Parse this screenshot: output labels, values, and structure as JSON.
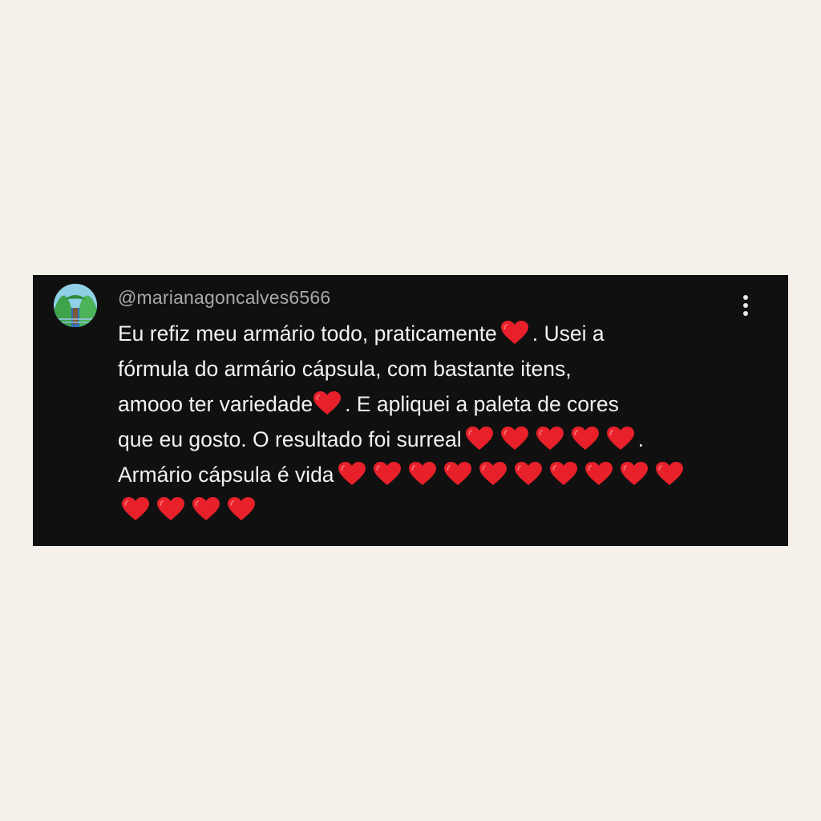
{
  "comment": {
    "username": "@marianagoncalves6566",
    "lines": [
      {
        "before": "Eu refiz meu armário todo, praticamente",
        "hearts": 1,
        "after": ". Usei a"
      },
      {
        "before": "fórmula do armário cápsula, com bastante itens,",
        "hearts": 0,
        "after": ""
      },
      {
        "before": "amooo ter variedade",
        "hearts": 1,
        "after": ". E apliquei a paleta de cores"
      },
      {
        "before": "que eu gosto. O resultado foi surreal",
        "hearts": 5,
        "after": "."
      },
      {
        "before": "Armário cápsula é vida",
        "hearts": 10,
        "after": ""
      },
      {
        "before": "",
        "hearts": 4,
        "after": ""
      }
    ],
    "heart_color": "#e8202a"
  },
  "icons": {
    "more": "more-vertical-icon",
    "heart": "red-heart-emoji",
    "avatar": "avatar-image"
  },
  "colors": {
    "page_background": "#f5f0ea",
    "card_background": "#101010",
    "username_text": "#a9a9a9",
    "comment_text": "#f2f2f2"
  }
}
